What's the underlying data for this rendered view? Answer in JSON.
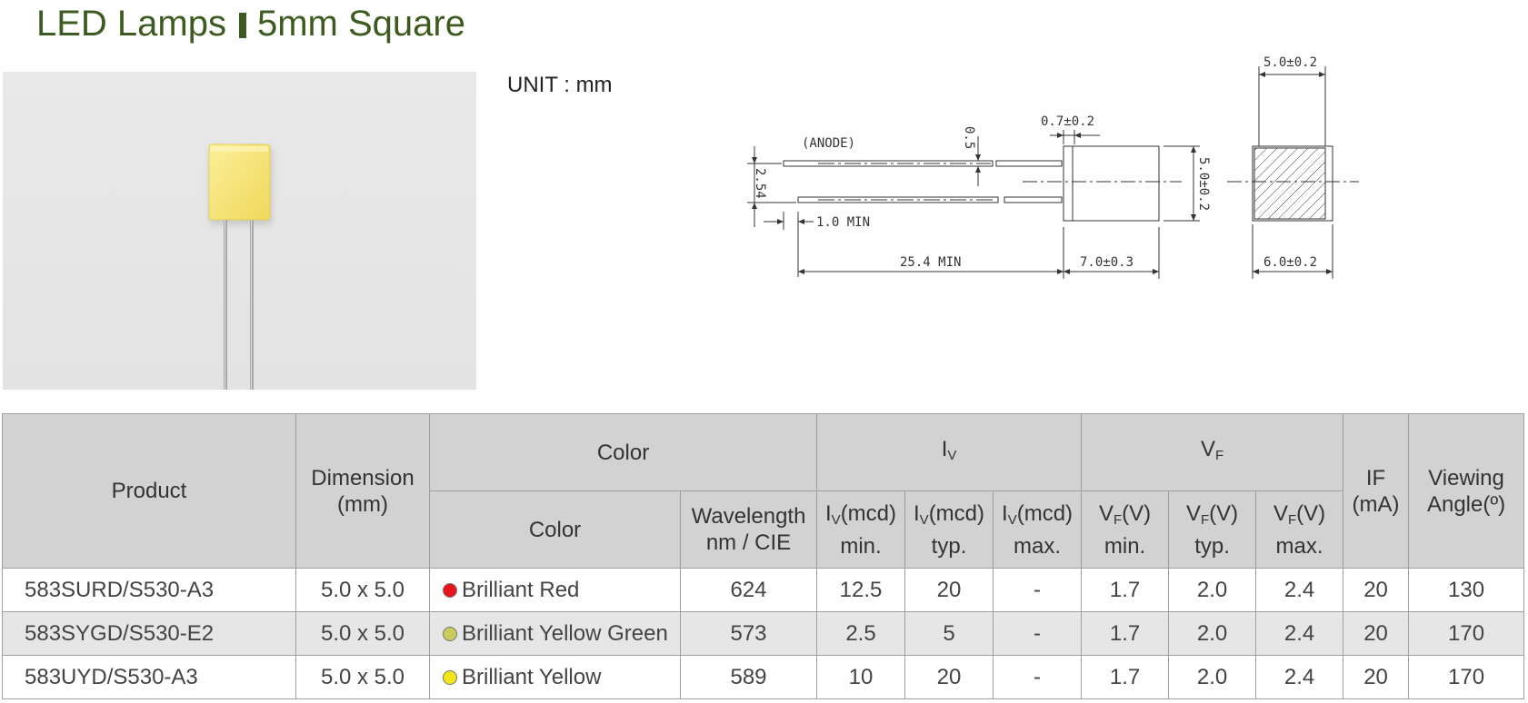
{
  "header": {
    "title_left": "LED Lamps",
    "title_right": "5mm Square",
    "unit": "UNIT : mm"
  },
  "drawing": {
    "anode": "(ANODE)",
    "dim_lead_thickness": "0.5",
    "dim_lead_width": "0.7±0.2",
    "dim_pitch": "2.54",
    "dim_min_spacing": "1.0 MIN",
    "dim_lead_length": "25.4 MIN",
    "dim_body_length": "7.0±0.3",
    "dim_body_height": "5.0±0.2",
    "dim_top_width": "5.0±0.2",
    "dim_base_width": "6.0±0.2"
  },
  "table": {
    "headers": {
      "product": "Product",
      "dimension_line1": "Dimension",
      "dimension_line2": "(mm)",
      "color_group": "Color",
      "color": "Color",
      "wavelength_line1": "Wavelength",
      "wavelength_line2": "nm / CIE",
      "iv_symbol": "I",
      "iv_sub": "V",
      "iv_unit": "(mcd)",
      "vf_symbol": "V",
      "vf_sub": "F",
      "vf_unit": "(V)",
      "min": "min.",
      "typ": "typ.",
      "max": "max.",
      "if_line1": "IF",
      "if_line2": "(mA)",
      "angle_line1": "Viewing",
      "angle_line2": "Angle(º)"
    },
    "rows": [
      {
        "product": "583SURD/S530-A3",
        "dimension": "5.0 x 5.0",
        "dot_color": "#e8141b",
        "color": "Brilliant Red",
        "wavelength": "624",
        "iv_min": "12.5",
        "iv_typ": "20",
        "iv_max": "-",
        "vf_min": "1.7",
        "vf_typ": "2.0",
        "vf_max": "2.4",
        "if": "20",
        "angle": "130"
      },
      {
        "product": "583SYGD/S530-E2",
        "dimension": "5.0 x 5.0",
        "dot_color": "#c8cc5a",
        "color": "Brilliant Yellow Green",
        "wavelength": "573",
        "iv_min": "2.5",
        "iv_typ": "5",
        "iv_max": "-",
        "vf_min": "1.7",
        "vf_typ": "2.0",
        "vf_max": "2.4",
        "if": "20",
        "angle": "170"
      },
      {
        "product": "583UYD/S530-A3",
        "dimension": "5.0 x 5.0",
        "dot_color": "#f2e51a",
        "color": "Brilliant Yellow",
        "wavelength": "589",
        "iv_min": "10",
        "iv_typ": "20",
        "iv_max": "-",
        "vf_min": "1.7",
        "vf_typ": "2.0",
        "vf_max": "2.4",
        "if": "20",
        "angle": "170"
      }
    ]
  }
}
